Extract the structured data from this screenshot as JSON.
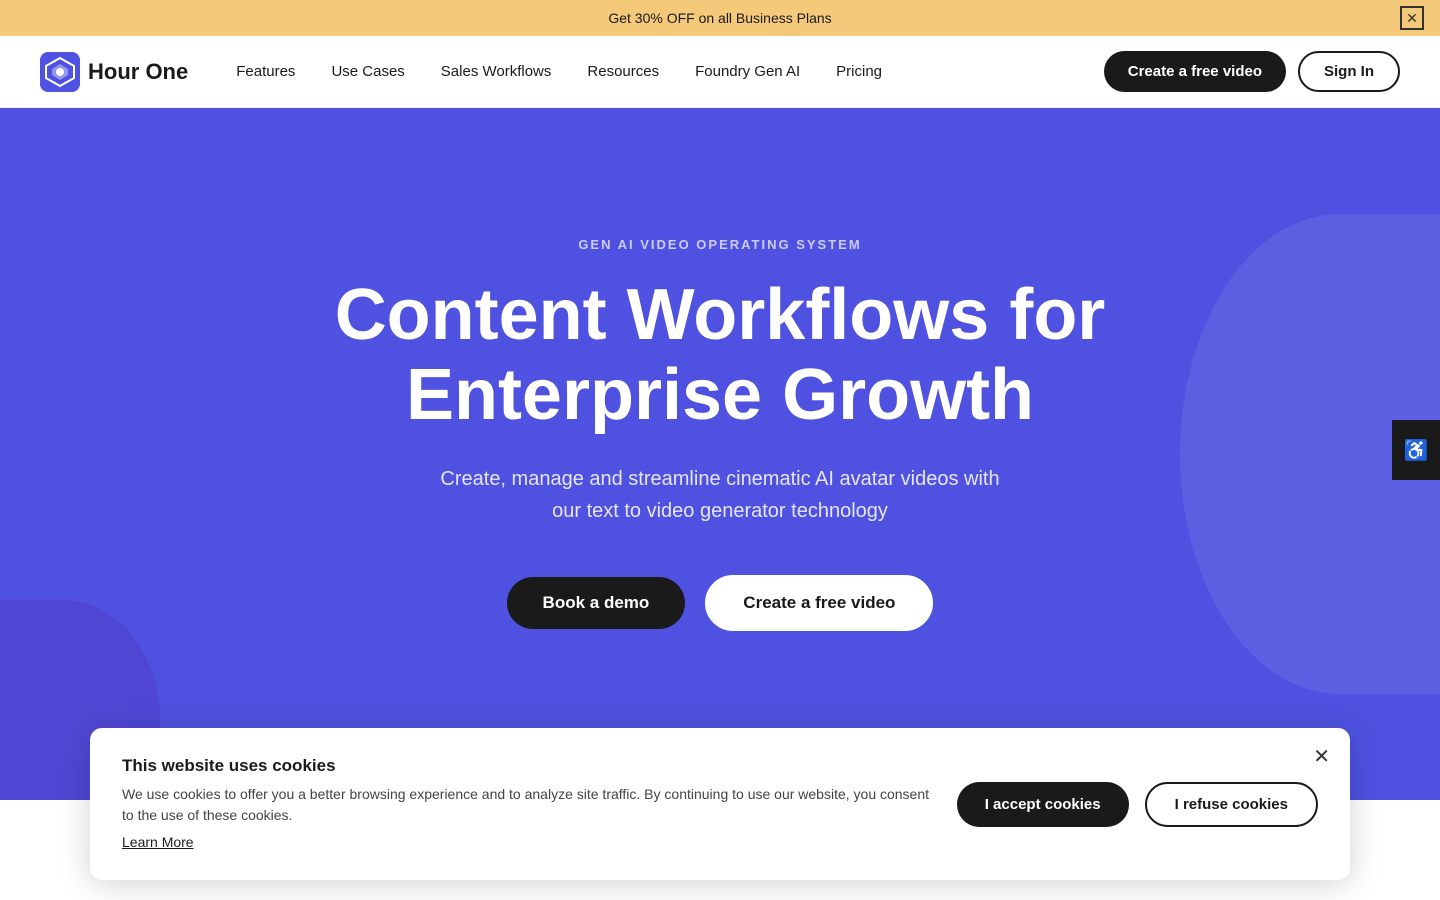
{
  "banner": {
    "text": "Get 30% OFF on all Business Plans",
    "close_label": "✕"
  },
  "nav": {
    "logo_text": "Hour One",
    "links": [
      {
        "label": "Features",
        "id": "features"
      },
      {
        "label": "Use Cases",
        "id": "use-cases"
      },
      {
        "label": "Sales Workflows",
        "id": "sales-workflows"
      },
      {
        "label": "Resources",
        "id": "resources"
      },
      {
        "label": "Foundry Gen AI",
        "id": "foundry-gen-ai"
      },
      {
        "label": "Pricing",
        "id": "pricing"
      }
    ],
    "create_btn": "Create a free video",
    "signin_btn": "Sign In"
  },
  "hero": {
    "eyebrow": "GEN AI VIDEO OPERATING SYSTEM",
    "title_line1": "Content Workflows for",
    "title_line2": "Enterprise Growth",
    "subtitle": "Create, manage and streamline cinematic AI avatar videos with our text to video generator technology",
    "book_demo_btn": "Book a demo",
    "create_video_btn": "Create a free video"
  },
  "accessibility": {
    "icon": "♿"
  },
  "cookie": {
    "title": "This website uses cookies",
    "description": "We use cookies to offer you a better browsing experience and to analyze site traffic. By continuing to use our website, you consent to the use of these cookies.",
    "learn_more": "Learn More",
    "accept_btn": "I accept cookies",
    "refuse_btn": "I refuse cookies",
    "close_icon": "✕"
  }
}
